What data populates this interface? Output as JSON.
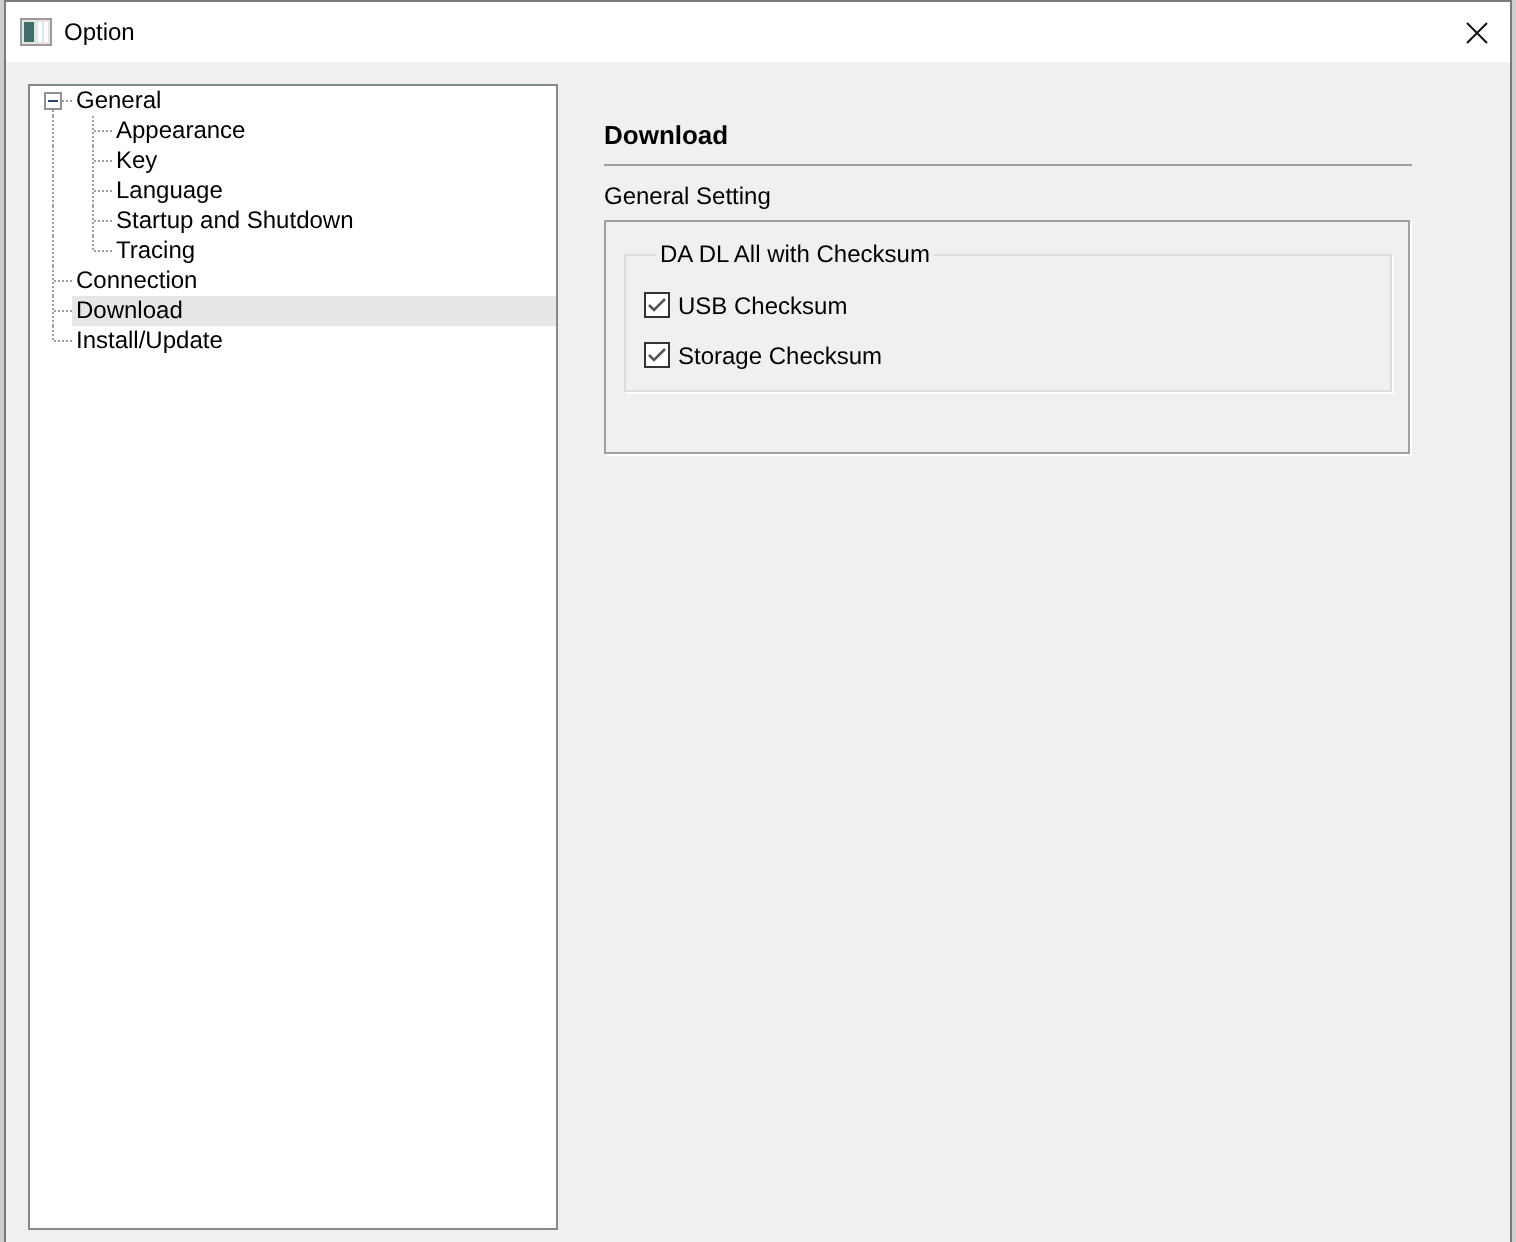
{
  "window": {
    "title": "Option"
  },
  "tree": {
    "items": [
      {
        "label": "General",
        "expanded": true,
        "selected": false,
        "children": [
          {
            "label": "Appearance",
            "selected": false
          },
          {
            "label": "Key",
            "selected": false
          },
          {
            "label": "Language",
            "selected": false
          },
          {
            "label": "Startup and Shutdown",
            "selected": false
          },
          {
            "label": "Tracing",
            "selected": false
          }
        ]
      },
      {
        "label": "Connection",
        "selected": false
      },
      {
        "label": "Download",
        "selected": true
      },
      {
        "label": "Install/Update",
        "selected": false
      }
    ]
  },
  "page": {
    "title": "Download",
    "section": "General Setting",
    "group": {
      "title": "DA DL All with Checksum",
      "options": [
        {
          "label": "USB Checksum",
          "checked": true
        },
        {
          "label": "Storage Checksum",
          "checked": true
        }
      ]
    }
  }
}
